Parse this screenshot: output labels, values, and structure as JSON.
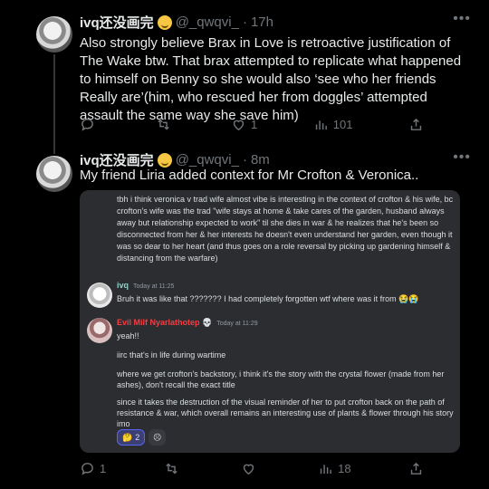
{
  "tweet1": {
    "display_name": "ivq还没画完",
    "handle": "@_qwqvi_",
    "dot": "·",
    "time": "17h",
    "text": "Also strongly believe Brax in Love is retroactive justification of The Wake btw. That brax attempted to replicate what happened to himself on Benny so she would also ‘see who her friends Really are’(him, who rescued her from doggles’ attempted assault the same way she save him)",
    "actions": {
      "replies": "",
      "retweets": "",
      "likes": "1",
      "views": "101"
    }
  },
  "tweet2": {
    "display_name": "ivq还没画完",
    "handle": "@_qwqvi_",
    "dot": "·",
    "time": "8m",
    "text": "My friend Liria added context for Mr Crofton & Veronica..",
    "actions": {
      "replies": "1",
      "retweets": "",
      "likes": "",
      "views": "18"
    }
  },
  "discord": {
    "quote": "tbh i think veronica v trad wife almost vibe is interesting in the context of crofton & his wife, bc crofton's wife was the trad \"wife stays at home & take cares of the garden, husband always away but relationship expected to work\" til she dies in war & he realizes that he's been so disconnected from her & her interests he doesn't even understand her garden, even though it was so dear to her heart (and thus goes on a role reversal by picking up gardening himself & distancing from the warfare)",
    "msg1": {
      "author": "ivq",
      "time": "Today at 11:25",
      "text": "Bruh it was like that ??????? I had completely forgotten wtf where was it from 😭😭"
    },
    "msg2": {
      "author": "Evil Milf Nyarlathotep 💀",
      "time": "Today at 11:29",
      "lines": [
        "yeah!!",
        "iirc that's in life during wartime",
        "where we get crofton's backstory, i think it's the story with the crystal flower (made from her ashes), don't recall the exact title",
        "since it takes the destruction of the visual reminder of her to put crofton back on the path of resistance & war, which overall remains an interesting use of plants & flower through his story imo"
      ]
    },
    "reactions": [
      {
        "emoji": "🤔",
        "count": "2"
      },
      {
        "emoji": "☹",
        "count": ""
      }
    ]
  },
  "colors": {
    "accent": "#1d9bf0",
    "muted": "#71767b",
    "discord_bg": "#2b2d31",
    "author2": "#f23f43"
  },
  "icons": [
    "more-icon",
    "reply-icon",
    "retweet-icon",
    "like-icon",
    "views-icon",
    "share-icon"
  ]
}
